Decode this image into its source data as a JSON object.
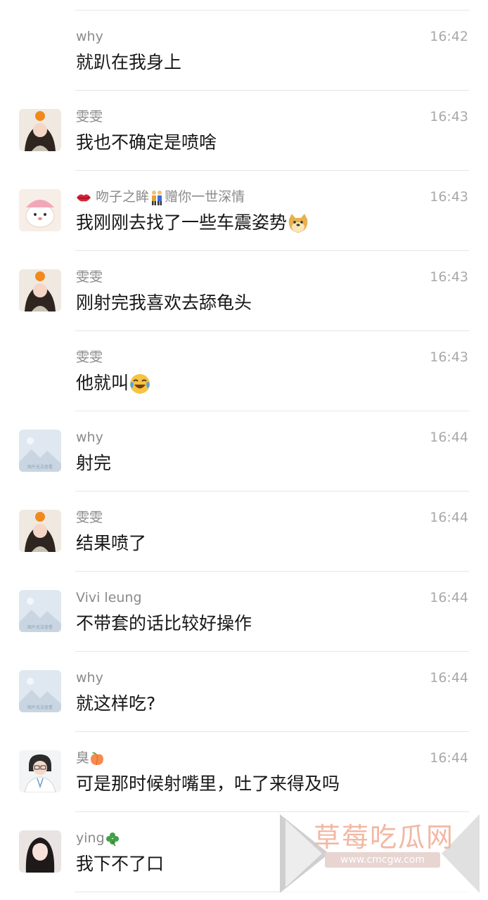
{
  "messages": [
    {
      "sender": "why",
      "time": "16:42",
      "text": "就趴在我身上",
      "avatar": "none"
    },
    {
      "sender": "雯雯",
      "time": "16:43",
      "text": "我也不确定是喷啥",
      "avatar": "girl-orange-hat"
    },
    {
      "sender": "吻子之眸",
      "sender_suffix": "赠你一世深情",
      "time": "16:43",
      "text": "我刚刚去找了一些车震姿势",
      "avatar": "cartoon-bear",
      "sender_icons": [
        "lips-emoji",
        "couple-emoji"
      ],
      "text_emoji": "doge-emoji"
    },
    {
      "sender": "雯雯",
      "time": "16:43",
      "text": "刚射完我喜欢去舔龟头",
      "avatar": "girl-orange-hat"
    },
    {
      "sender": "雯雯",
      "time": "16:43",
      "text": "他就叫",
      "avatar": "none",
      "text_emoji": "laugh-cry-emoji"
    },
    {
      "sender": "why",
      "time": "16:44",
      "text": "射完",
      "avatar": "placeholder-image"
    },
    {
      "sender": "雯雯",
      "time": "16:44",
      "text": "结果喷了",
      "avatar": "girl-orange-hat"
    },
    {
      "sender": "Vivi leung",
      "time": "16:44",
      "text": "不带套的话比较好操作",
      "avatar": "placeholder-image"
    },
    {
      "sender": "why",
      "time": "16:44",
      "text": "就这样吃?",
      "avatar": "placeholder-image"
    },
    {
      "sender": "臭",
      "time": "16:44",
      "text": "可是那时候射嘴里，吐了来得及吗",
      "avatar": "doctor-illustration",
      "sender_icons_after": [
        "peach-emoji"
      ]
    },
    {
      "sender": "ying",
      "time": "",
      "text": "我下不了口",
      "avatar": "girl-photo",
      "sender_icons_after": [
        "clover-emoji"
      ]
    }
  ],
  "placeholder_caption": "图片无法查看",
  "watermark": {
    "title": "草莓吃瓜网",
    "url": "www.cmcgw.com"
  },
  "colors": {
    "text": "#161616",
    "meta": "#8a8a8a",
    "divider": "#e6e6e6",
    "watermark": "#f2b8a3"
  }
}
